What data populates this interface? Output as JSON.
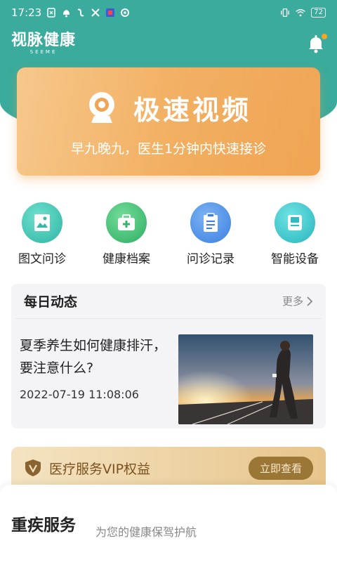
{
  "status_bar": {
    "time": "17:23",
    "battery": "72",
    "icons": [
      "sim-card-icon",
      "notification-bell-icon",
      "app-icon",
      "tools-icon",
      "app-badge-icon",
      "sync-icon",
      "vibrate-icon",
      "wifi-icon",
      "battery-icon"
    ]
  },
  "header": {
    "logo_text": "视脉健康",
    "logo_sub": "SEEME",
    "bell_icon": "bell-icon",
    "brand_color": "#3aab9c"
  },
  "banner": {
    "title": "极速视频",
    "subtitle": "早九晚九，医生1分钟内快速接诊",
    "icon": "webcam-icon"
  },
  "menu": {
    "items": [
      {
        "label": "图文问诊",
        "icon": "image-consult-icon",
        "color": "#3cc2b0"
      },
      {
        "label": "健康档案",
        "icon": "medical-kit-icon",
        "color": "#3fbf78"
      },
      {
        "label": "问诊记录",
        "icon": "clipboard-icon",
        "color": "#4a90e8"
      },
      {
        "label": "智能设备",
        "icon": "device-icon",
        "color": "#33c4c9"
      }
    ]
  },
  "daily": {
    "title": "每日动态",
    "more_label": "更多",
    "article": {
      "title": "夏季养生如何健康排汗，要注意什么?",
      "time": "2022-07-19 11:08:06"
    }
  },
  "vip": {
    "label": "医疗服务VIP权益",
    "button": "立即查看"
  },
  "section": {
    "title": "重疾服务",
    "subtitle": "为您的健康保驾护航"
  }
}
